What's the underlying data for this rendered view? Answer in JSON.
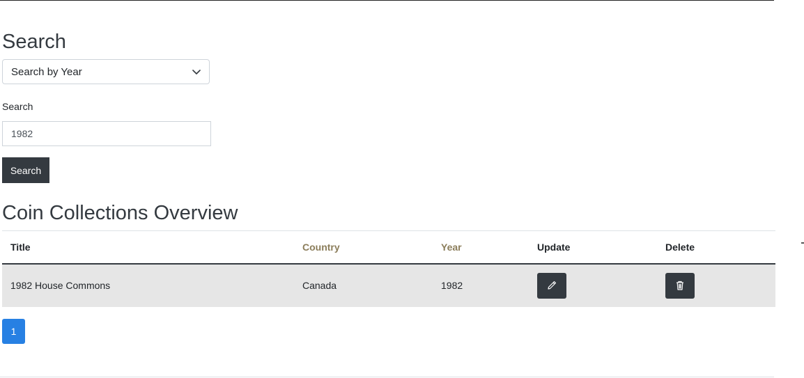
{
  "search_section": {
    "heading": "Search",
    "select_value": "Search by Year",
    "field_label": "Search",
    "field_value": "1982",
    "button_label": "Search"
  },
  "overview": {
    "heading": "Coin Collections Overview",
    "columns": [
      "Title",
      "Country",
      "Year",
      "Update",
      "Delete"
    ],
    "sortable_color": "#8b7d5a",
    "rows": [
      {
        "title": "1982 House Commons",
        "country": "Canada",
        "year": "1982",
        "update_icon": "pencil-icon",
        "delete_icon": "trash-icon"
      }
    ]
  },
  "pagination": {
    "current_page": "1",
    "accent_color": "#2780e3"
  },
  "colors": {
    "dark_button": "#343a40",
    "row_highlight": "#e6e6e6"
  }
}
